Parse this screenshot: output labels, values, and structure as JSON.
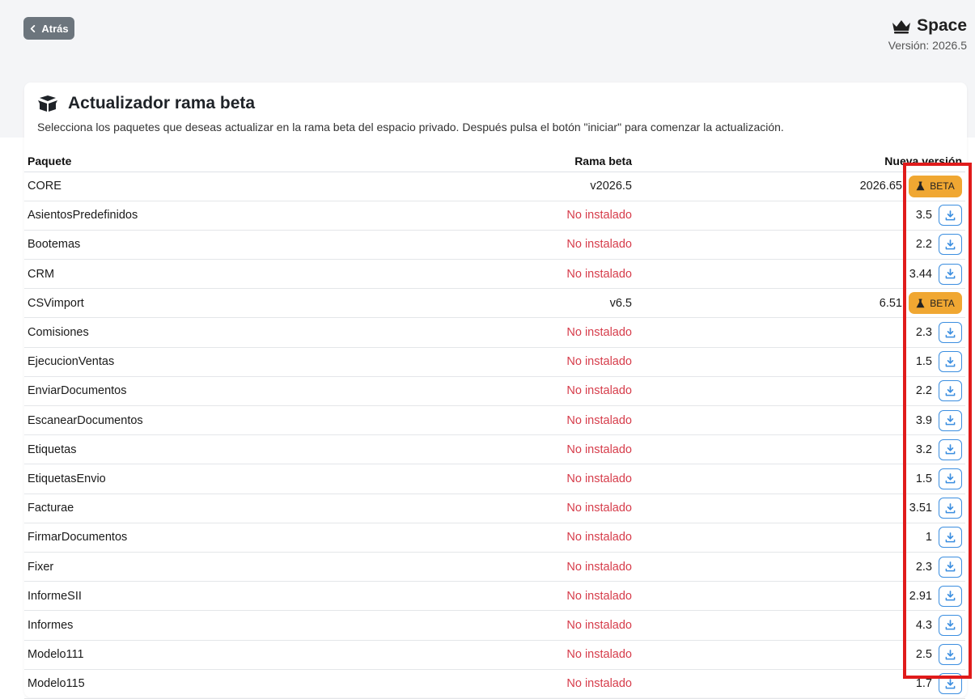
{
  "header": {
    "back_label": "Atrás",
    "brand_name": "Space",
    "version_text": "Versión: 2026.5"
  },
  "card": {
    "title": "Actualizador rama beta",
    "description": "Selecciona los paquetes que deseas actualizar en la rama beta del espacio privado. Después pulsa el botón \"iniciar\" para comenzar la actualización."
  },
  "table": {
    "columns": [
      "Paquete",
      "Rama beta",
      "Nueva versión"
    ],
    "rows": [
      {
        "name": "CORE",
        "beta": "v2026.5",
        "installed": true,
        "new_version": "2026.65",
        "action": "BETA"
      },
      {
        "name": "AsientosPredefinidos",
        "beta": "No instalado",
        "installed": false,
        "new_version": "3.5",
        "action": "download"
      },
      {
        "name": "Bootemas",
        "beta": "No instalado",
        "installed": false,
        "new_version": "2.2",
        "action": "download"
      },
      {
        "name": "CRM",
        "beta": "No instalado",
        "installed": false,
        "new_version": "3.44",
        "action": "download"
      },
      {
        "name": "CSVimport",
        "beta": "v6.5",
        "installed": true,
        "new_version": "6.51",
        "action": "BETA"
      },
      {
        "name": "Comisiones",
        "beta": "No instalado",
        "installed": false,
        "new_version": "2.3",
        "action": "download"
      },
      {
        "name": "EjecucionVentas",
        "beta": "No instalado",
        "installed": false,
        "new_version": "1.5",
        "action": "download"
      },
      {
        "name": "EnviarDocumentos",
        "beta": "No instalado",
        "installed": false,
        "new_version": "2.2",
        "action": "download"
      },
      {
        "name": "EscanearDocumentos",
        "beta": "No instalado",
        "installed": false,
        "new_version": "3.9",
        "action": "download"
      },
      {
        "name": "Etiquetas",
        "beta": "No instalado",
        "installed": false,
        "new_version": "3.2",
        "action": "download"
      },
      {
        "name": "EtiquetasEnvio",
        "beta": "No instalado",
        "installed": false,
        "new_version": "1.5",
        "action": "download"
      },
      {
        "name": "Facturae",
        "beta": "No instalado",
        "installed": false,
        "new_version": "3.51",
        "action": "download"
      },
      {
        "name": "FirmarDocumentos",
        "beta": "No instalado",
        "installed": false,
        "new_version": "1",
        "action": "download"
      },
      {
        "name": "Fixer",
        "beta": "No instalado",
        "installed": false,
        "new_version": "2.3",
        "action": "download"
      },
      {
        "name": "InformeSII",
        "beta": "No instalado",
        "installed": false,
        "new_version": "2.91",
        "action": "download"
      },
      {
        "name": "Informes",
        "beta": "No instalado",
        "installed": false,
        "new_version": "4.3",
        "action": "download"
      },
      {
        "name": "Modelo111",
        "beta": "No instalado",
        "installed": false,
        "new_version": "2.5",
        "action": "download"
      },
      {
        "name": "Modelo115",
        "beta": "No instalado",
        "installed": false,
        "new_version": "1.7",
        "action": "download"
      }
    ]
  },
  "colors": {
    "accent_blue": "#3b8ee0",
    "beta_orange": "#f0a732",
    "missing_red": "#d63c4a",
    "highlight_red": "#e01b1b"
  },
  "icons": [
    "chevron-left-icon",
    "crown-icon",
    "box-open-icon",
    "download-icon",
    "flask-icon"
  ]
}
